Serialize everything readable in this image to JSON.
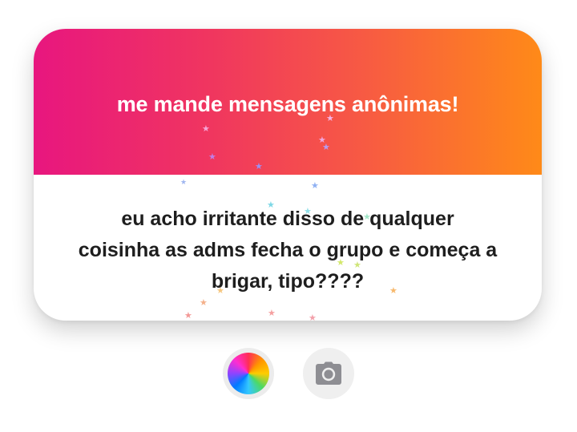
{
  "card": {
    "title": "me mande mensagens anônimas!",
    "message_lines": [
      "eu acho irritante disso de qualquer",
      "coisinha as adms fecha o grupo e começa a",
      "brigar, tipo????"
    ]
  },
  "colors": {
    "gradient_start": "#e8167f",
    "gradient_end": "#ff8a18",
    "text_dark": "#1e1e1e",
    "button_bg": "#ececec",
    "camera_icon": "#8e8e93"
  },
  "controls": {
    "color_button_icon": "color-wheel-icon",
    "camera_button_icon": "camera-icon"
  },
  "decorations": {
    "confetti_icon": "star-icon"
  }
}
